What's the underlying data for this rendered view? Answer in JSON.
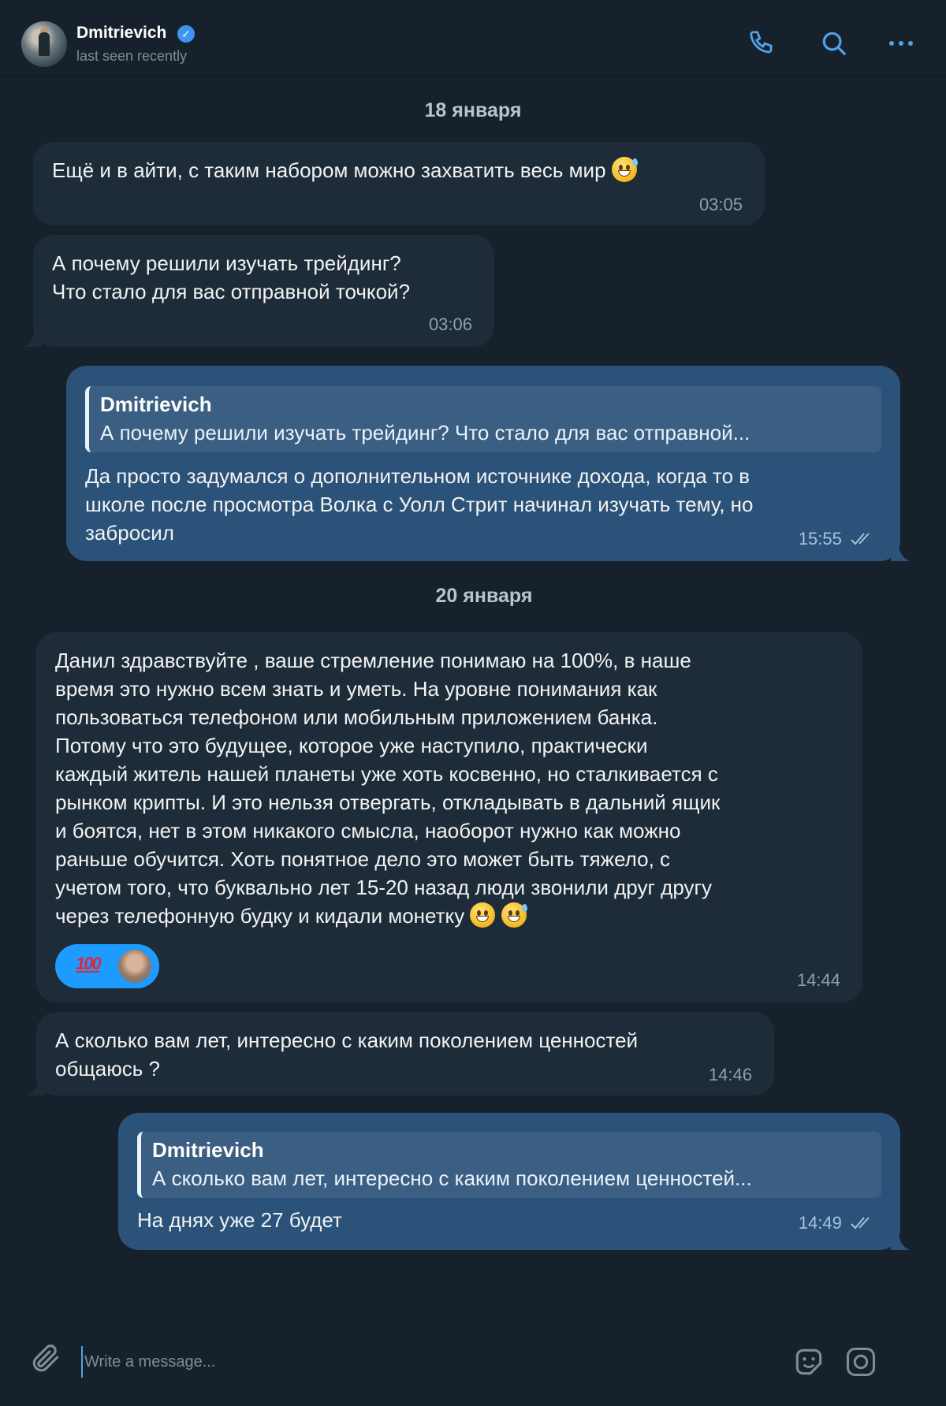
{
  "header": {
    "contact_name": "Dmitrievich",
    "status": "last seen recently",
    "icons": [
      "phone-icon",
      "search-icon",
      "more-icon",
      "verified-icon"
    ]
  },
  "dates": [
    "18 января",
    "20 января"
  ],
  "messages": [
    {
      "direction": "in",
      "text": "Ещё и в айти, с таким набором можно захватить весь мир",
      "time": "03:05",
      "emoji": "sweat-smile"
    },
    {
      "direction": "in",
      "text": "А почему решили изучать трейдинг?\nЧто стало для вас отправной точкой?",
      "time": "03:06"
    },
    {
      "direction": "out",
      "reply_name": "Dmitrievich",
      "reply_text": "А почему решили изучать трейдинг? Что стало для вас отправной...",
      "text": "Да просто задумался о дополнительном источнике дохода, когда то в\nшколе после просмотра Волка с Уолл Стрит начинал изучать тему, но\nзабросил",
      "time": "15:55"
    },
    {
      "direction": "in",
      "text": "Данил здравствуйте , ваше стремление понимаю на 100%, в наше\nвремя это нужно всем знать и уметь. На уровне понимания как\nпользоваться телефоном или мобильным приложением банка.\nПотому что это будущее, которое уже наступило, практически\nкаждый житель нашей планеты уже хоть косвенно, но сталкивается с\nрынком крипты. И это нельзя отвергать, откладывать в дальний ящик\nи боятся, нет в этом никакого смысла, наоборот нужно как можно\nраньше обучится. Хоть понятное дело это может быть тяжело, с\nучетом того, что буквально лет 15-20 назад люди звонили друг другу\nчерез телефонную будку и кидали монетку",
      "time": "14:44",
      "reaction": "100"
    },
    {
      "direction": "in",
      "text": "А сколько вам лет, интересно с каким поколением ценностей\nобщаюсь ?",
      "time": "14:46"
    },
    {
      "direction": "out",
      "reply_name": "Dmitrievich",
      "reply_text": "А сколько вам лет, интересно с каким поколением ценностей...",
      "text": "На днях уже 27 будет",
      "time": "14:49"
    }
  ],
  "composer": {
    "placeholder": "Write a message...",
    "icons": [
      "attach-icon",
      "sticker-icon",
      "camera-icon"
    ]
  },
  "colors": {
    "background": "#17212b",
    "incoming_bubble": "#1e2c3a",
    "outgoing_bubble": "#2b5278",
    "accent": "#4fa3ea"
  }
}
